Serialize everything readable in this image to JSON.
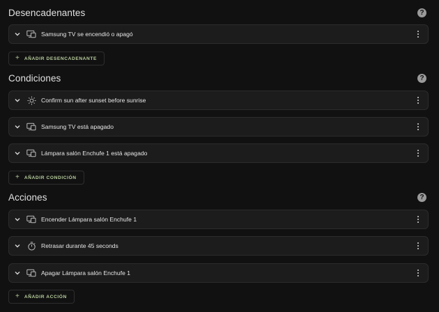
{
  "triggers": {
    "title": "Desencadenantes",
    "items": [
      {
        "label": "Samsung TV se encendió o apagó",
        "icon": "device-icon"
      }
    ],
    "add_label": "AÑADIR DESENCADENANTE"
  },
  "conditions": {
    "title": "Condiciones",
    "items": [
      {
        "label": "Confirm sun after sunset before sunrise",
        "icon": "sun-icon"
      },
      {
        "label": "Samsung TV está apagado",
        "icon": "device-icon"
      },
      {
        "label": "Lámpara salón Enchufe 1 está apagado",
        "icon": "device-icon"
      }
    ],
    "add_label": "AÑADIR CONDICIÓN"
  },
  "actions": {
    "title": "Acciones",
    "items": [
      {
        "label": "Encender Lámpara salón Enchufe 1",
        "icon": "device-icon"
      },
      {
        "label": "Retrasar durante 45 seconds",
        "icon": "timer-icon"
      },
      {
        "label": "Apagar Lámpara salón Enchufe 1",
        "icon": "device-icon"
      }
    ],
    "add_label": "AÑADIR ACCIÓN"
  },
  "help_glyph": "?",
  "plus_glyph": "+",
  "colors": {
    "background": "#111111",
    "card": "#1c1c1c",
    "accent": "#b9cf9e"
  }
}
